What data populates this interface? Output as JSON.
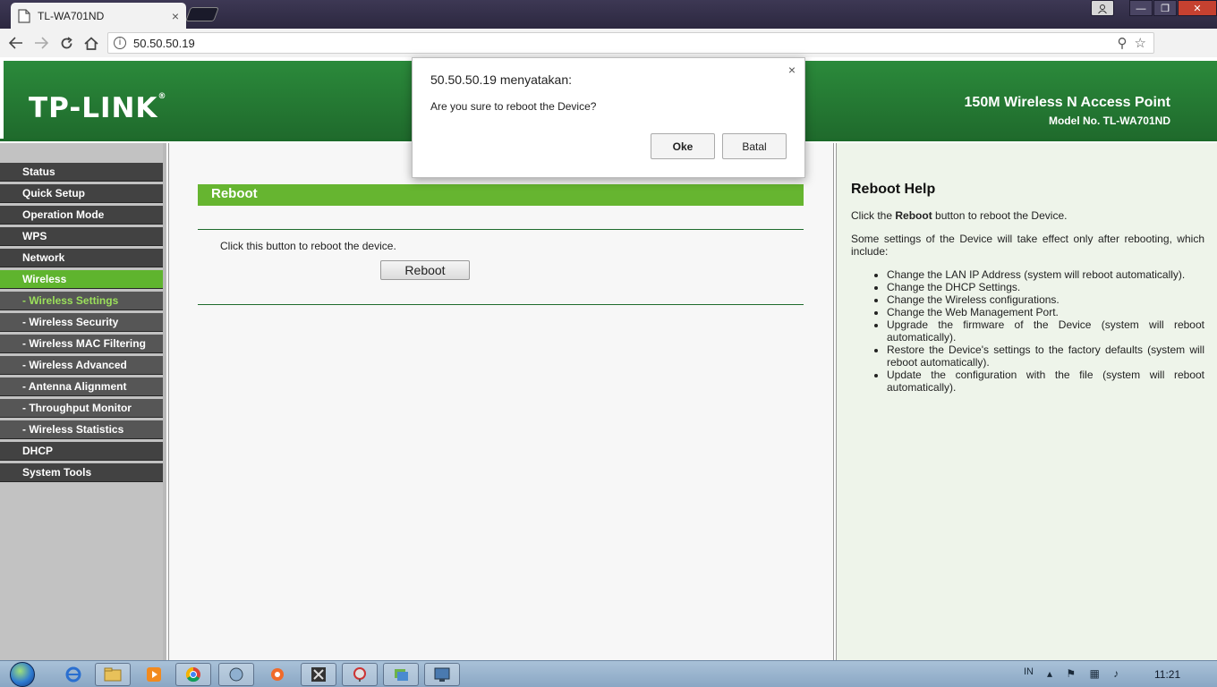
{
  "browser": {
    "tab_title": "TL-WA701ND",
    "tab_close": "×",
    "url": "50.50.50.19",
    "window_controls": [
      "—",
      "❐",
      "✕"
    ]
  },
  "banner": {
    "logo": "TP-LINK",
    "logo_mark": "®",
    "product_title": "150M Wireless N Access Point",
    "model": "Model No. TL-WA701ND"
  },
  "sidebar": {
    "items": [
      {
        "label": "Status",
        "sub": false,
        "active": false
      },
      {
        "label": "Quick Setup",
        "sub": false,
        "active": false
      },
      {
        "label": "Operation Mode",
        "sub": false,
        "active": false
      },
      {
        "label": "WPS",
        "sub": false,
        "active": false
      },
      {
        "label": "Network",
        "sub": false,
        "active": false
      },
      {
        "label": "Wireless",
        "sub": false,
        "active": true
      },
      {
        "label": "- Wireless Settings",
        "sub": true,
        "active": true
      },
      {
        "label": "- Wireless Security",
        "sub": true,
        "active": false
      },
      {
        "label": "- Wireless MAC Filtering",
        "sub": true,
        "active": false
      },
      {
        "label": "- Wireless Advanced",
        "sub": true,
        "active": false
      },
      {
        "label": "- Antenna Alignment",
        "sub": true,
        "active": false
      },
      {
        "label": "- Throughput Monitor",
        "sub": true,
        "active": false
      },
      {
        "label": "- Wireless Statistics",
        "sub": true,
        "active": false
      },
      {
        "label": "DHCP",
        "sub": false,
        "active": false
      },
      {
        "label": "System Tools",
        "sub": false,
        "active": false
      }
    ]
  },
  "main": {
    "section_title": "Reboot",
    "description": "Click this button to reboot the device.",
    "reboot_button": "Reboot"
  },
  "help": {
    "title": "Reboot Help",
    "p1_prefix": "Click the ",
    "p1_bold": "Reboot",
    "p1_suffix": " button to reboot the Device.",
    "p2": "Some settings of the Device will take effect only after rebooting, which include:",
    "list": [
      "Change the LAN IP Address (system will reboot automatically).",
      "Change the DHCP Settings.",
      "Change the Wireless configurations.",
      "Change the Web Management Port.",
      "Upgrade the firmware of the Device (system will reboot automatically).",
      "Restore the Device's settings to the factory defaults (system will reboot automatically).",
      "Update the configuration with the file (system will reboot automatically)."
    ]
  },
  "dialog": {
    "title": "50.50.50.19 menyatakan:",
    "message": "Are you sure to reboot the Device?",
    "ok_label": "Oke",
    "cancel_label": "Batal",
    "close": "×"
  },
  "taskbar": {
    "language": "IN",
    "clock": "11:21"
  },
  "colors": {
    "banner_green": "#2b8a3b",
    "section_green": "#66b530",
    "menu_dark": "#424242",
    "menu_active": "#5fb42e",
    "submenu_active_text": "#9be05b"
  }
}
